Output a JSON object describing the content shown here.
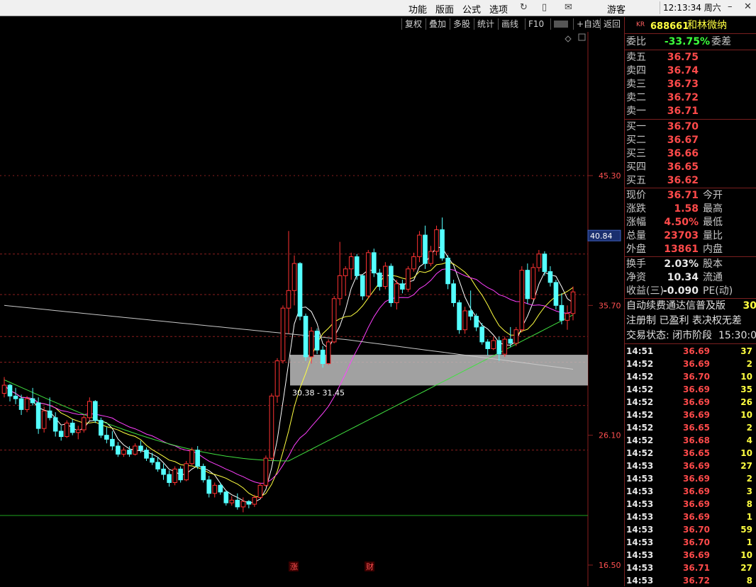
{
  "menubar": {
    "items": [
      "功能",
      "版面",
      "公式",
      "选项"
    ],
    "guest": "游客",
    "time": "12:13:34",
    "weekday": "周六"
  },
  "toolbar": {
    "items": [
      "复权",
      "叠加",
      "多股",
      "统计",
      "画线",
      "F10",
      "",
      "+自选",
      "返回"
    ]
  },
  "stock": {
    "badge": "KR",
    "code": "688661",
    "name": "和林微纳"
  },
  "committee": {
    "label": "委比",
    "value": "-33.75%",
    "label2": "委差"
  },
  "asks": [
    {
      "label": "卖五",
      "price": "36.75"
    },
    {
      "label": "卖四",
      "price": "36.74"
    },
    {
      "label": "卖三",
      "price": "36.73"
    },
    {
      "label": "卖二",
      "price": "36.72"
    },
    {
      "label": "卖一",
      "price": "36.71"
    }
  ],
  "bids": [
    {
      "label": "买一",
      "price": "36.70"
    },
    {
      "label": "买二",
      "price": "36.67"
    },
    {
      "label": "买三",
      "price": "36.66"
    },
    {
      "label": "买四",
      "price": "36.65"
    },
    {
      "label": "买五",
      "price": "36.62"
    }
  ],
  "quote": [
    {
      "label": "现价",
      "value": "36.71",
      "label2": "今开"
    },
    {
      "label": "涨跌",
      "value": "1.58",
      "label2": "最高"
    },
    {
      "label": "涨幅",
      "value": "4.50%",
      "label2": "最低"
    },
    {
      "label": "总量",
      "value": "23703",
      "label2": "量比"
    },
    {
      "label": "外盘",
      "value": "13861",
      "label2": "内盘"
    }
  ],
  "fundamentals": [
    {
      "label": "换手",
      "value": "2.03%",
      "label2": "股本"
    },
    {
      "label": "净资",
      "value": "10.34",
      "label2": "流通"
    },
    {
      "label": "收益(三)",
      "value": "-0.090",
      "label2": "PE(动)"
    }
  ],
  "info_lines": {
    "line1": "自动续费通达信普及版",
    "line1_extra": "30",
    "line2": "注册制 已盈利 表决权无差",
    "status_label": "交易状态: 闭市阶段",
    "status_time": "15:30:0"
  },
  "ticks": [
    {
      "time": "14:51",
      "price": "36.69",
      "vol": "37",
      "dir": "up"
    },
    {
      "time": "14:52",
      "price": "36.69",
      "vol": "2",
      "dir": "up"
    },
    {
      "time": "14:52",
      "price": "36.70",
      "vol": "10",
      "dir": "up"
    },
    {
      "time": "14:52",
      "price": "36.69",
      "vol": "35",
      "dir": "up"
    },
    {
      "time": "14:52",
      "price": "36.69",
      "vol": "26",
      "dir": "up"
    },
    {
      "time": "14:52",
      "price": "36.69",
      "vol": "10",
      "dir": "up"
    },
    {
      "time": "14:52",
      "price": "36.65",
      "vol": "2",
      "dir": "up"
    },
    {
      "time": "14:52",
      "price": "36.68",
      "vol": "4",
      "dir": "up"
    },
    {
      "time": "14:52",
      "price": "36.65",
      "vol": "10",
      "dir": "up"
    },
    {
      "time": "14:53",
      "price": "36.69",
      "vol": "27",
      "dir": "up"
    },
    {
      "time": "14:53",
      "price": "36.69",
      "vol": "2",
      "dir": "up"
    },
    {
      "time": "14:53",
      "price": "36.69",
      "vol": "3",
      "dir": "up"
    },
    {
      "time": "14:53",
      "price": "36.69",
      "vol": "8",
      "dir": "up"
    },
    {
      "time": "14:53",
      "price": "36.69",
      "vol": "1",
      "dir": "up"
    },
    {
      "time": "14:53",
      "price": "36.70",
      "vol": "59",
      "dir": "up"
    },
    {
      "time": "14:53",
      "price": "36.70",
      "vol": "1",
      "dir": "up"
    },
    {
      "time": "14:53",
      "price": "36.69",
      "vol": "10",
      "dir": "up"
    },
    {
      "time": "14:53",
      "price": "36.71",
      "vol": "27",
      "dir": "up"
    },
    {
      "time": "14:53",
      "price": "36.72",
      "vol": "8",
      "dir": "up"
    }
  ],
  "chart_data": {
    "type": "candlestick",
    "y_axis_labels": [
      "45.30",
      "35.70",
      "26.10",
      "16.50"
    ],
    "ylim": [
      16.5,
      45.3
    ],
    "crosshair_label": "40.84",
    "range_label": "30.38 - 31.45",
    "markers": [
      "涨",
      "财"
    ],
    "candles": [
      [
        29.2,
        30.4,
        28.9,
        29.8
      ],
      [
        29.8,
        29.9,
        28.6,
        29.0
      ],
      [
        29.0,
        29.6,
        28.4,
        28.8
      ],
      [
        28.8,
        29.1,
        27.6,
        28.0
      ],
      [
        28.0,
        29.0,
        27.8,
        28.8
      ],
      [
        28.8,
        29.6,
        28.3,
        28.5
      ],
      [
        28.5,
        28.9,
        26.2,
        26.6
      ],
      [
        26.6,
        28.2,
        26.3,
        27.9
      ],
      [
        27.9,
        28.9,
        27.2,
        27.4
      ],
      [
        27.4,
        27.8,
        26.0,
        26.4
      ],
      [
        26.4,
        26.8,
        25.7,
        26.0
      ],
      [
        26.0,
        27.2,
        25.9,
        27.0
      ],
      [
        27.0,
        27.3,
        26.1,
        26.3
      ],
      [
        26.3,
        26.8,
        25.8,
        26.5
      ],
      [
        26.5,
        27.6,
        26.3,
        27.4
      ],
      [
        27.4,
        28.9,
        27.2,
        28.6
      ],
      [
        28.6,
        28.7,
        27.0,
        27.2
      ],
      [
        27.2,
        27.4,
        25.9,
        26.1
      ],
      [
        26.1,
        26.7,
        25.5,
        25.8
      ],
      [
        25.8,
        26.4,
        25.0,
        25.3
      ],
      [
        25.3,
        25.6,
        24.5,
        24.7
      ],
      [
        24.7,
        25.2,
        24.5,
        25.0
      ],
      [
        25.0,
        25.3,
        24.5,
        24.7
      ],
      [
        24.7,
        25.5,
        24.6,
        25.3
      ],
      [
        25.3,
        25.7,
        24.8,
        25.0
      ],
      [
        25.0,
        25.2,
        24.2,
        24.4
      ],
      [
        24.4,
        24.8,
        23.9,
        24.1
      ],
      [
        24.1,
        24.5,
        23.4,
        23.6
      ],
      [
        23.6,
        24.0,
        22.8,
        23.2
      ],
      [
        23.2,
        23.5,
        22.3,
        22.6
      ],
      [
        22.6,
        23.8,
        22.4,
        23.6
      ],
      [
        23.6,
        23.8,
        22.6,
        22.8
      ],
      [
        22.8,
        24.2,
        22.7,
        24.0
      ],
      [
        24.0,
        25.2,
        23.9,
        25.0
      ],
      [
        25.0,
        25.3,
        23.6,
        23.8
      ],
      [
        23.8,
        24.0,
        22.6,
        22.8
      ],
      [
        22.8,
        23.1,
        21.5,
        21.8
      ],
      [
        21.8,
        22.6,
        21.5,
        22.4
      ],
      [
        22.4,
        22.6,
        21.7,
        21.9
      ],
      [
        21.9,
        22.0,
        20.9,
        21.1
      ],
      [
        21.1,
        21.6,
        20.9,
        21.3
      ],
      [
        21.3,
        21.8,
        20.6,
        20.8
      ],
      [
        20.8,
        21.5,
        20.4,
        21.2
      ],
      [
        21.2,
        21.3,
        20.7,
        21.0
      ],
      [
        21.0,
        21.7,
        20.8,
        21.5
      ],
      [
        21.5,
        22.6,
        21.4,
        22.4
      ],
      [
        22.4,
        24.6,
        22.3,
        24.4
      ],
      [
        24.4,
        29.2,
        24.2,
        29.0
      ],
      [
        29.0,
        31.8,
        28.5,
        31.6
      ],
      [
        31.6,
        35.7,
        31.4,
        35.5
      ],
      [
        35.5,
        41.2,
        33.6,
        36.8
      ],
      [
        36.8,
        39.4,
        35.7,
        38.8
      ],
      [
        38.8,
        38.9,
        34.6,
        34.9
      ],
      [
        34.9,
        35.1,
        31.6,
        31.9
      ],
      [
        31.9,
        34.1,
        31.4,
        33.8
      ],
      [
        33.8,
        34.0,
        32.1,
        32.4
      ],
      [
        32.4,
        32.7,
        31.1,
        31.4
      ],
      [
        31.4,
        33.2,
        31.3,
        33.0
      ],
      [
        33.0,
        36.4,
        32.9,
        36.2
      ],
      [
        36.2,
        40.4,
        35.7,
        37.9
      ],
      [
        37.9,
        38.6,
        36.4,
        38.4
      ],
      [
        38.4,
        39.6,
        37.6,
        39.3
      ],
      [
        39.3,
        39.5,
        37.6,
        37.9
      ],
      [
        37.9,
        38.0,
        36.1,
        36.4
      ],
      [
        36.4,
        39.8,
        36.2,
        39.6
      ],
      [
        39.6,
        39.9,
        37.8,
        38.1
      ],
      [
        38.1,
        38.4,
        36.8,
        37.1
      ],
      [
        37.1,
        38.9,
        36.9,
        38.6
      ],
      [
        38.6,
        38.8,
        35.6,
        35.9
      ],
      [
        35.9,
        37.6,
        35.4,
        37.3
      ],
      [
        37.3,
        37.6,
        36.6,
        36.9
      ],
      [
        36.9,
        38.6,
        36.7,
        38.4
      ],
      [
        38.4,
        39.6,
        38.2,
        39.3
      ],
      [
        39.3,
        41.2,
        38.9,
        40.9
      ],
      [
        40.9,
        41.6,
        38.4,
        38.8
      ],
      [
        38.8,
        40.1,
        38.6,
        39.7
      ],
      [
        39.7,
        41.6,
        39.4,
        41.3
      ],
      [
        41.3,
        42.2,
        39.0,
        39.2
      ],
      [
        39.2,
        39.4,
        36.9,
        37.3
      ],
      [
        37.3,
        37.6,
        35.6,
        35.9
      ],
      [
        35.9,
        36.1,
        33.6,
        33.9
      ],
      [
        33.9,
        35.6,
        33.6,
        35.3
      ],
      [
        35.3,
        36.8,
        34.6,
        34.9
      ],
      [
        34.9,
        35.1,
        33.8,
        34.1
      ],
      [
        34.1,
        34.4,
        32.8,
        33.0
      ],
      [
        33.0,
        33.2,
        32.0,
        32.5
      ],
      [
        32.5,
        33.4,
        32.4,
        33.1
      ],
      [
        33.1,
        33.4,
        31.6,
        32.1
      ],
      [
        32.1,
        33.4,
        31.9,
        33.2
      ],
      [
        33.2,
        34.1,
        32.6,
        32.9
      ],
      [
        32.9,
        34.1,
        32.7,
        33.9
      ],
      [
        33.9,
        38.6,
        33.7,
        38.3
      ],
      [
        38.3,
        38.8,
        35.8,
        36.2
      ],
      [
        36.2,
        38.8,
        36.1,
        38.5
      ],
      [
        38.5,
        39.8,
        38.2,
        39.5
      ],
      [
        39.5,
        39.7,
        37.9,
        38.2
      ],
      [
        38.2,
        38.6,
        37.1,
        37.4
      ],
      [
        37.4,
        37.6,
        35.4,
        35.7
      ],
      [
        35.7,
        36.6,
        34.3,
        34.6
      ],
      [
        34.6,
        35.7,
        33.9,
        35.1
      ],
      [
        35.1,
        37.1,
        34.6,
        36.7
      ]
    ]
  }
}
